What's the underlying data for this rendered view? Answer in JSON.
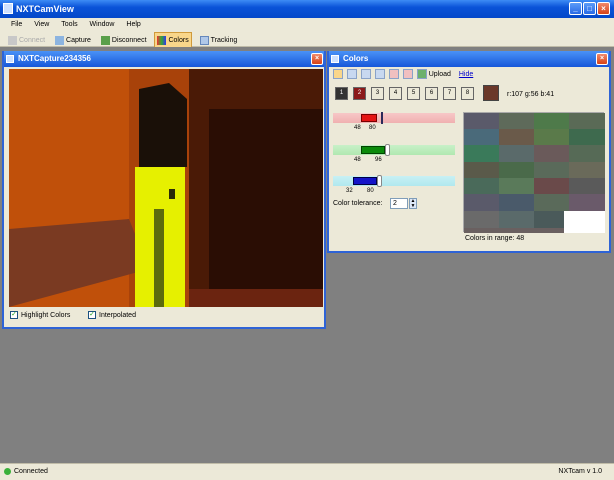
{
  "app": {
    "title": "NXTCamView"
  },
  "menu": [
    "File",
    "View",
    "Tools",
    "Window",
    "Help"
  ],
  "toolbar": {
    "connect": "Connect",
    "capture": "Capture",
    "disconnect": "Disconnect",
    "colors": "Colors",
    "tracking": "Tracking"
  },
  "capture_window": {
    "title": "NXTCapture234356",
    "highlight": "Highlight Colors",
    "interpolated": "Interpolated"
  },
  "colors_window": {
    "title": "Colors",
    "upload": "Upload",
    "hide": "Hide",
    "swatches": [
      "1",
      "2",
      "3",
      "4",
      "5",
      "6",
      "7",
      "8"
    ],
    "selected_swatch": "#6b3829",
    "rgb_text": "r:107 g:56 b:41",
    "red": {
      "low": "48",
      "high": "80"
    },
    "green": {
      "low": "48",
      "high": "96"
    },
    "blue": {
      "low": "32",
      "high": "80"
    },
    "tolerance_label": "Color tolerance:",
    "tolerance_value": "2",
    "in_range": "Colors in range: 48"
  },
  "status": {
    "left": "Connected",
    "right": "NXTcam v 1.0"
  },
  "colors": {
    "accent": "#0a53d8",
    "highlight": "#e6f000"
  }
}
